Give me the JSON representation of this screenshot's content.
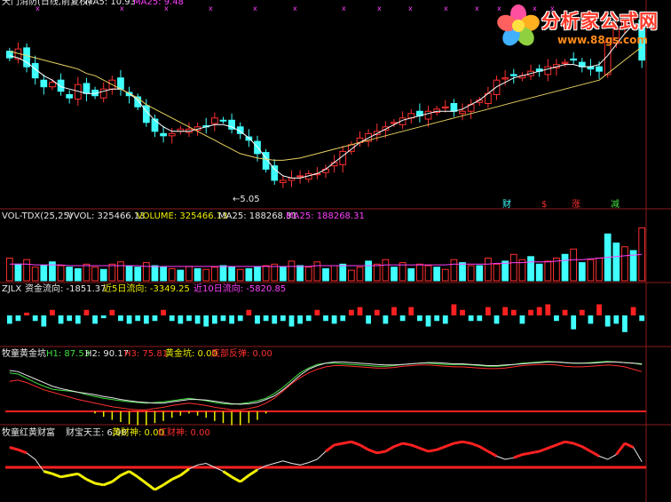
{
  "panels": {
    "price": {
      "header_left": "天门消防(日线,前复权)",
      "ma5_label": "MA5: 10.93",
      "ma25_label": "MA25: 9.48",
      "low_marker": "←5.05",
      "signals": [
        "财",
        "$",
        "涨",
        "减"
      ]
    },
    "volume": {
      "name": "VOL-TDX(25,25)",
      "vol": "VVOL: 325466.13",
      "volume": "VOLUME: 325466.13",
      "ma25a": "MA25: 188268.31",
      "ma25b": "MA25: 188268.31"
    },
    "fund": {
      "name": "ZJLX",
      "flow": "资金流向: -1851.37",
      "d5": "近5日流向: -3349.25",
      "d10": "近10日流向: -5820.85"
    },
    "golden": {
      "name": "牧童黄金坑",
      "h1": "H1: 87.53",
      "h2": "H2: 90.17",
      "h3": "H3: 75.81",
      "pit": "黄金坑: 0.00",
      "rebound": "底部反弹: 0.00"
    },
    "wealth": {
      "name": "牧童红黄财富",
      "king": "财宝天王: 6.98",
      "yellow": "黄财神: 0.00",
      "red": "红财神: 0.00"
    }
  },
  "logo": {
    "title": "分析家公式网",
    "url": "www.88gs.com"
  },
  "chart_data": [
    {
      "type": "candlestick",
      "title": "天门消防(日线,前复权)",
      "series_names": [
        "MA5",
        "MA25"
      ],
      "colors": {
        "up": "#ff3030",
        "down": "#40ffff",
        "ma5": "#ffffff",
        "ma25": "#e8d060"
      },
      "close": [
        11.0,
        11.4,
        10.6,
        10.1,
        9.7,
        9.9,
        9.5,
        9.2,
        9.8,
        9.4,
        9.3,
        9.6,
        10.0,
        9.6,
        9.3,
        8.8,
        8.1,
        7.7,
        7.5,
        7.6,
        7.8,
        7.8,
        7.9,
        7.9,
        8.3,
        8.2,
        7.8,
        7.6,
        7.3,
        6.7,
        6.0,
        5.5,
        5.5,
        5.6,
        5.7,
        5.8,
        5.8,
        6.0,
        6.3,
        6.8,
        7.1,
        7.4,
        7.6,
        7.7,
        7.9,
        8.1,
        8.3,
        8.5,
        8.4,
        8.6,
        8.7,
        8.8,
        8.6,
        8.6,
        8.9,
        9.1,
        9.4,
        10.0,
        10.1,
        10.2,
        10.2,
        10.4,
        10.4,
        10.6,
        10.7,
        10.8,
        10.9,
        10.6,
        10.5,
        10.4,
        11.7,
        12.3,
        12.6,
        12.8,
        10.9
      ],
      "ma5": [
        11.1,
        11.0,
        10.8,
        10.5,
        10.2,
        10.0,
        9.7,
        9.6,
        9.5,
        9.4,
        9.4,
        9.5,
        9.6,
        9.6,
        9.4,
        9.1,
        8.6,
        8.2,
        7.9,
        7.7,
        7.7,
        7.7,
        7.8,
        7.9,
        8.0,
        8.0,
        7.9,
        7.7,
        7.4,
        7.0,
        6.5,
        6.0,
        5.7,
        5.6,
        5.6,
        5.7,
        5.8,
        6.0,
        6.3,
        6.6,
        6.9,
        7.2,
        7.4,
        7.6,
        7.8,
        8.0,
        8.2,
        8.3,
        8.4,
        8.5,
        8.6,
        8.6,
        8.6,
        8.7,
        8.9,
        9.1,
        9.4,
        9.7,
        9.9,
        10.1,
        10.2,
        10.3,
        10.4,
        10.5,
        10.6,
        10.7,
        10.7,
        10.6,
        10.6,
        10.7,
        11.1,
        11.6,
        12.1,
        12.5,
        12.3
      ],
      "ma25": [
        11.3,
        11.2,
        11.1,
        11.0,
        10.9,
        10.8,
        10.7,
        10.6,
        10.5,
        10.3,
        10.2,
        10.0,
        9.8,
        9.6,
        9.4,
        9.2,
        8.9,
        8.7,
        8.5,
        8.3,
        8.1,
        7.9,
        7.7,
        7.5,
        7.3,
        7.1,
        6.9,
        6.7,
        6.6,
        6.5,
        6.45,
        6.4,
        6.4,
        6.45,
        6.5,
        6.6,
        6.7,
        6.8,
        6.9,
        7.0,
        7.1,
        7.2,
        7.3,
        7.4,
        7.5,
        7.6,
        7.7,
        7.8,
        7.9,
        8.0,
        8.1,
        8.2,
        8.3,
        8.4,
        8.5,
        8.6,
        8.7,
        8.8,
        8.9,
        9.0,
        9.1,
        9.2,
        9.3,
        9.4,
        9.5,
        9.6,
        9.7,
        9.8,
        9.9,
        10.0,
        10.3,
        10.6,
        10.9,
        11.2,
        11.5
      ],
      "ylim": [
        4.5,
        13.2
      ],
      "annotations": [
        "←5.05"
      ]
    },
    {
      "type": "bar",
      "title": "VOL-TDX(25,25)",
      "values": [
        30,
        22,
        28,
        18,
        20,
        25,
        20,
        18,
        16,
        22,
        18,
        15,
        22,
        25,
        20,
        18,
        24,
        20,
        18,
        16,
        14,
        19,
        16,
        15,
        18,
        20,
        18,
        15,
        16,
        18,
        20,
        22,
        18,
        26,
        20,
        18,
        25,
        16,
        20,
        22,
        14,
        18,
        26,
        22,
        28,
        18,
        24,
        16,
        22,
        20,
        18,
        15,
        28,
        24,
        20,
        20,
        30,
        22,
        26,
        35,
        28,
        32,
        22,
        26,
        30,
        35,
        42,
        24,
        28,
        30,
        62,
        50,
        45,
        40,
        70
      ],
      "up_down": [
        "u",
        "d",
        "u",
        "u",
        "d",
        "d",
        "u",
        "d",
        "d",
        "u",
        "u",
        "d",
        "u",
        "u",
        "d",
        "d",
        "u",
        "d",
        "d",
        "u",
        "d",
        "u",
        "d",
        "u",
        "u",
        "d",
        "d",
        "u",
        "d",
        "d",
        "u",
        "u",
        "d",
        "u",
        "d",
        "u",
        "u",
        "d",
        "u",
        "d",
        "u",
        "u",
        "d",
        "u",
        "u",
        "d",
        "u",
        "d",
        "u",
        "u",
        "d",
        "u",
        "u",
        "d",
        "u",
        "d",
        "u",
        "u",
        "d",
        "u",
        "u",
        "d",
        "d",
        "u",
        "u",
        "d",
        "u",
        "d",
        "u",
        "u",
        "d",
        "d",
        "u",
        "d",
        "u"
      ],
      "ma25": [
        22,
        22,
        22,
        21,
        21,
        21,
        21,
        20,
        20,
        20,
        20,
        20,
        20,
        20,
        20,
        20,
        19,
        19,
        19,
        19,
        19,
        19,
        19,
        19,
        19,
        19,
        19,
        19,
        19,
        19,
        19,
        19,
        19,
        19,
        19,
        19,
        20,
        20,
        20,
        20,
        20,
        20,
        20,
        20,
        21,
        21,
        21,
        21,
        21,
        21,
        21,
        21,
        22,
        22,
        22,
        22,
        22,
        23,
        23,
        24,
        24,
        25,
        25,
        25,
        26,
        27,
        28,
        28,
        29,
        30,
        31,
        32,
        33,
        34,
        35
      ],
      "ylim": [
        0,
        80
      ]
    },
    {
      "type": "bar",
      "title": "ZJLX",
      "values": [
        -3,
        -2,
        1,
        -2,
        -4,
        2,
        -3,
        -2,
        -3,
        2,
        -3,
        -1,
        2,
        -2,
        -3,
        -2,
        -3,
        -2,
        2,
        -2,
        -3,
        -2,
        -3,
        -4,
        -3,
        -2,
        -3,
        -2,
        2,
        -3,
        -2,
        -3,
        -2,
        -4,
        -3,
        -2,
        2,
        -2,
        -3,
        -2,
        2,
        3,
        -3,
        2,
        -3,
        3,
        -2,
        3,
        -2,
        -4,
        -2,
        -3,
        4,
        2,
        -2,
        -2,
        3,
        -3,
        3,
        2,
        -3,
        2,
        3,
        4,
        -2,
        2,
        -5,
        2,
        -3,
        4,
        -4,
        -3,
        -6,
        3,
        -2
      ],
      "ylim": [
        -8,
        8
      ]
    },
    {
      "type": "line",
      "title": "牧童黄金坑",
      "series": [
        {
          "name": "H1",
          "values": [
            74,
            72,
            65,
            58,
            52,
            47,
            45,
            44,
            42,
            38,
            35,
            32,
            30,
            28,
            26,
            25,
            24,
            25,
            26,
            28,
            30,
            32,
            30,
            28,
            25,
            23,
            22,
            23,
            25,
            28,
            32,
            40,
            50,
            62,
            74,
            82,
            88,
            90,
            90,
            89,
            88,
            87,
            86,
            85,
            85,
            86,
            88,
            89,
            90,
            90,
            89,
            88,
            88,
            88,
            87,
            86,
            85,
            85,
            86,
            88,
            90,
            91,
            92,
            93,
            92,
            91,
            90,
            90,
            91,
            92,
            93,
            92,
            91,
            90,
            88
          ]
        },
        {
          "name": "H2",
          "values": [
            78,
            76,
            70,
            64,
            58,
            52,
            48,
            45,
            42,
            40,
            38,
            35,
            33,
            30,
            28,
            26,
            25,
            24,
            24,
            26,
            28,
            30,
            30,
            29,
            27,
            25,
            23,
            22,
            23,
            25,
            30,
            36,
            46,
            58,
            70,
            80,
            86,
            90,
            92,
            92,
            91,
            90,
            89,
            88,
            87,
            87,
            88,
            89,
            90,
            91,
            91,
            90,
            89,
            89,
            88,
            87,
            86,
            86,
            87,
            88,
            89,
            90,
            91,
            92,
            92,
            91,
            90,
            90,
            90,
            91,
            92,
            92,
            91,
            90,
            89
          ]
        },
        {
          "name": "H3",
          "values": [
            60,
            62,
            58,
            52,
            46,
            42,
            38,
            34,
            30,
            27,
            24,
            21,
            18,
            16,
            14,
            13,
            13,
            15,
            17,
            20,
            22,
            24,
            22,
            20,
            17,
            15,
            13,
            13,
            15,
            18,
            24,
            32,
            44,
            56,
            66,
            74,
            80,
            84,
            86,
            86,
            85,
            84,
            83,
            82,
            82,
            83,
            85,
            86,
            87,
            87,
            86,
            85,
            84,
            84,
            83,
            82,
            81,
            81,
            82,
            84,
            86,
            87,
            88,
            88,
            87,
            85,
            84,
            84,
            85,
            86,
            87,
            86,
            84,
            80,
            76
          ]
        }
      ],
      "ylim": [
        0,
        100
      ]
    },
    {
      "type": "line",
      "title": "牧童红黄财富",
      "series": [
        {
          "name": "财宝天王",
          "values": [
            25,
            22,
            18,
            10,
            -5,
            -8,
            -12,
            -10,
            -8,
            -15,
            -20,
            -22,
            -18,
            -10,
            -5,
            -12,
            -20,
            -28,
            -22,
            -15,
            -10,
            -2,
            3,
            5,
            0,
            -5,
            -12,
            -18,
            -10,
            -3,
            2,
            5,
            8,
            5,
            3,
            6,
            10,
            20,
            28,
            30,
            32,
            28,
            22,
            18,
            20,
            26,
            30,
            28,
            24,
            20,
            22,
            26,
            30,
            32,
            30,
            26,
            20,
            14,
            10,
            12,
            16,
            18,
            20,
            24,
            28,
            32,
            30,
            26,
            20,
            14,
            10,
            16,
            30,
            25,
            7
          ]
        }
      ],
      "ylim": [
        -35,
        40
      ]
    }
  ]
}
